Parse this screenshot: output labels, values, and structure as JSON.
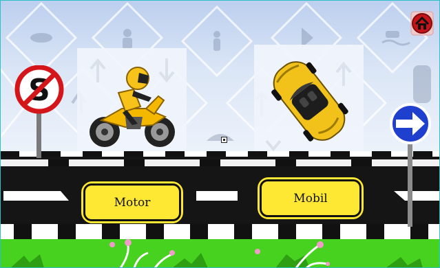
{
  "game": {
    "choices": [
      {
        "label": "Motor"
      },
      {
        "label": "Mobil"
      }
    ],
    "icons": {
      "home": "home-icon",
      "no_stopping": "no-stopping-sign",
      "direction": "right-arrow-sign",
      "motorbike": "motorbike-picture",
      "car": "car-picture"
    },
    "colors": {
      "button_fill": "#ffe833",
      "road": "#151515",
      "grass": "#46d21f",
      "sky": "#bccfef"
    }
  }
}
